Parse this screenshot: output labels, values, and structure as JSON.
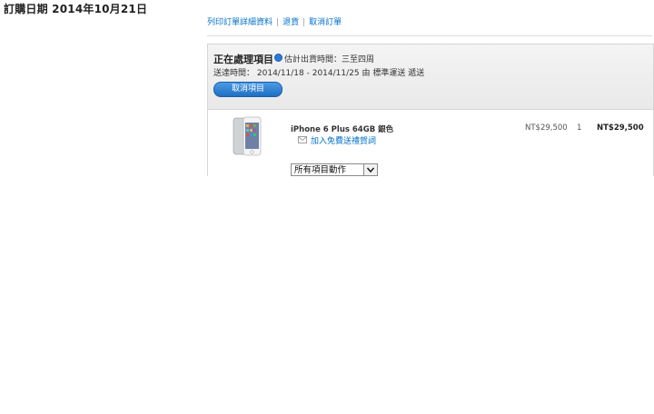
{
  "order": {
    "date_label": "訂購日期 2014年10月21日"
  },
  "top_links": {
    "print_details": "列印訂單詳細資料",
    "returns": "退貨",
    "cancel_order": "取消訂單"
  },
  "shipment": {
    "status_title": "正在處理項目",
    "ship_label": "估計出貨時間：三至四周",
    "delivery_label": "送達時間：",
    "delivery_text": "2014/11/18 - 2014/11/25 由 標準運送 遞送",
    "cancel_button": "取消項目"
  },
  "item": {
    "name": "iPhone 6 Plus 64GB 銀色",
    "gift_link": "加入免費送禮賀詞",
    "unit_price": "NT$29,500",
    "quantity": "1",
    "total": "NT$29,500",
    "action_select": "所有項目動作"
  },
  "icons": {
    "info": "info-icon",
    "gift": "envelope-icon",
    "dropdown": "chevron-down-icon"
  },
  "colors": {
    "link": "#0070c9",
    "button": "#1e6fc2"
  }
}
